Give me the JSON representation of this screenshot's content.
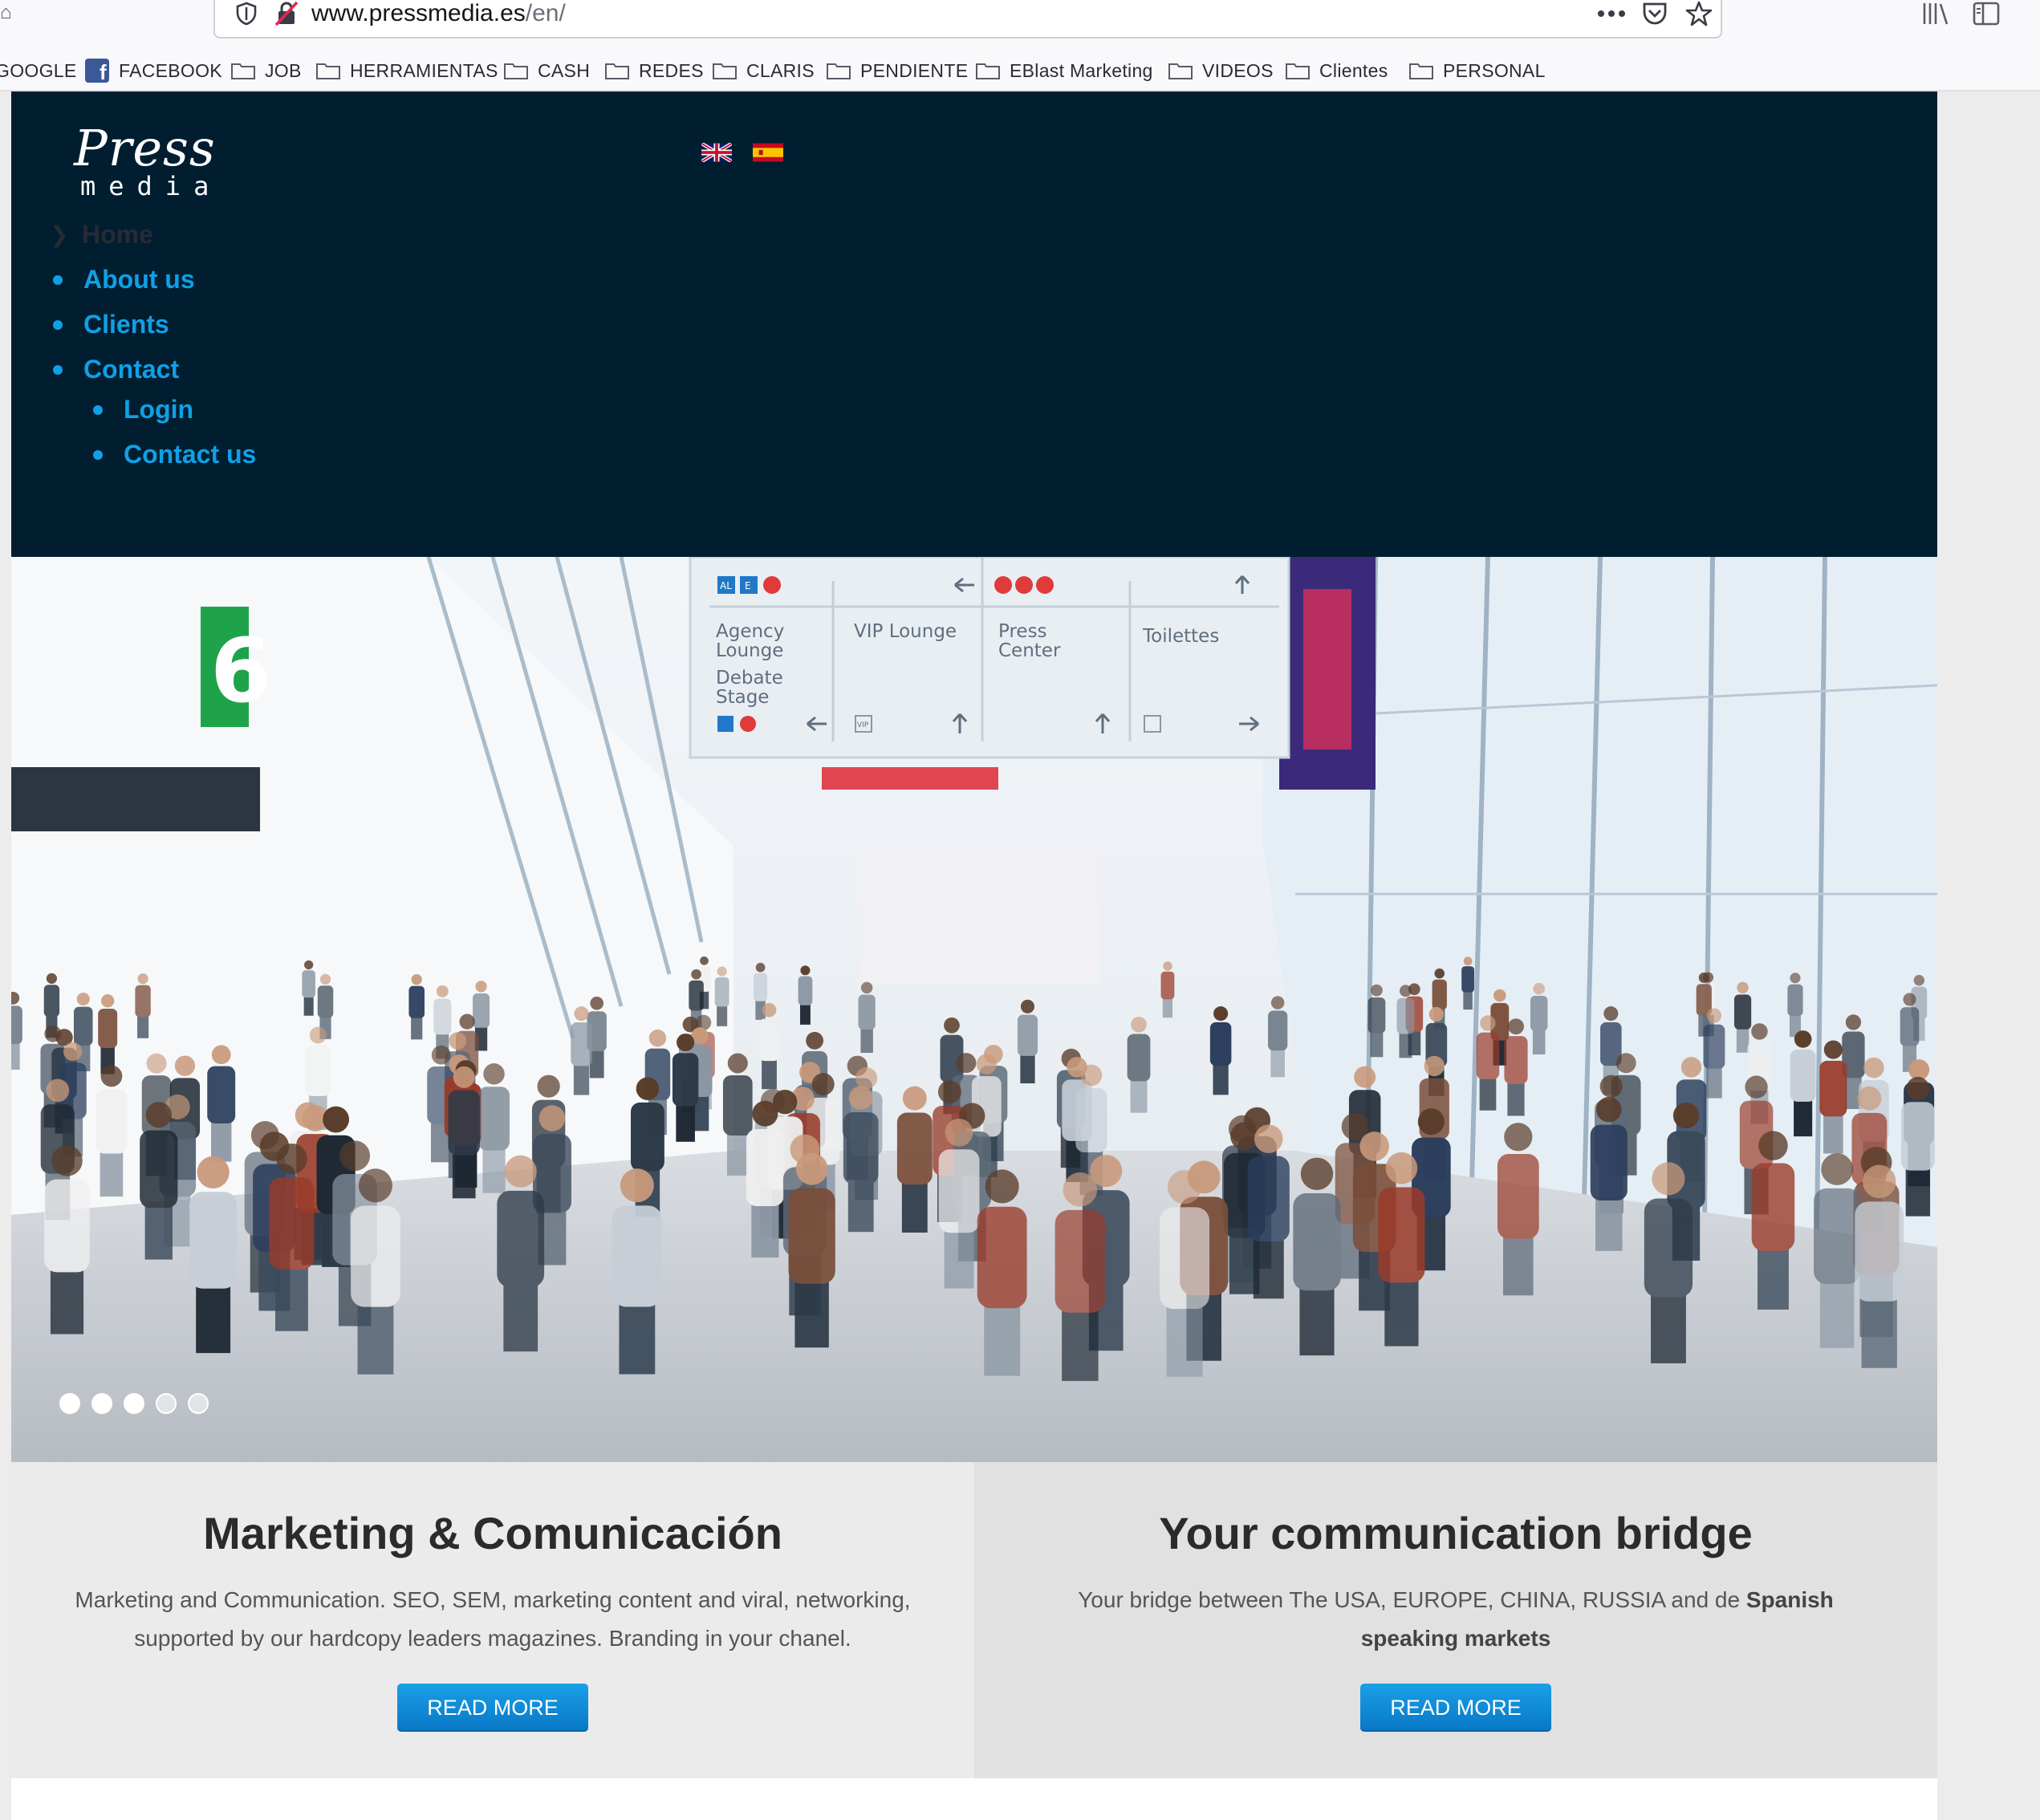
{
  "browser": {
    "url_host": "www.pressmedia.es",
    "url_path": "/en/",
    "bookmarks": [
      {
        "label": "GOOGLE",
        "icon": "none"
      },
      {
        "label": "FACEBOOK",
        "icon": "facebook-icon"
      },
      {
        "label": "JOB",
        "icon": "folder-icon"
      },
      {
        "label": "HERRAMIENTAS",
        "icon": "folder-icon"
      },
      {
        "label": "CASH",
        "icon": "folder-icon"
      },
      {
        "label": "REDES",
        "icon": "folder-icon"
      },
      {
        "label": "CLARIS",
        "icon": "folder-icon"
      },
      {
        "label": "PENDIENTE",
        "icon": "folder-icon"
      },
      {
        "label": "EBlast Marketing",
        "icon": "folder-icon"
      },
      {
        "label": "VIDEOS",
        "icon": "folder-icon"
      },
      {
        "label": "Clientes",
        "icon": "folder-icon"
      },
      {
        "label": "PERSONAL",
        "icon": "folder-icon"
      }
    ],
    "icons": [
      "shield-icon",
      "insecure-lock-icon",
      "more-icon",
      "pocket-icon",
      "star-icon",
      "library-icon",
      "sidebar-icon"
    ]
  },
  "site": {
    "logo_line1": "Press",
    "logo_line2": "media",
    "languages": [
      "uk-flag-icon",
      "spain-flag-icon"
    ],
    "nav": {
      "home": "Home",
      "about": "About us",
      "clients": "Clients",
      "contact": "Contact",
      "login": "Login",
      "contact_us": "Contact us"
    },
    "colors": {
      "header_bg": "#001e30",
      "accent": "#0fa0e6"
    }
  },
  "hero": {
    "sign": {
      "agency": "Agency",
      "lounge": "Lounge",
      "debate": "Debate",
      "stage": "Stage",
      "vip": "VIP Lounge",
      "press": "Press",
      "center": "Center",
      "toilettes": "Toilettes",
      "badge_al": "AL",
      "badge_e": "E",
      "badge_vip": "VIP"
    },
    "hall_number": "6",
    "slides": 5,
    "active_slide": 1
  },
  "panels": {
    "left": {
      "title": "Marketing & Comunicación",
      "body": "Marketing and Communication. SEO, SEM, marketing content and viral, networking, supported by our hardcopy leaders magazines. Branding in your chanel.",
      "button": "READ MORE"
    },
    "right": {
      "title": "Your communication bridge",
      "body_prefix": "Your bridge between The USA, EUROPE, CHINA, RUSSIA and de ",
      "body_bold": "Spanish speaking markets",
      "button": "READ MORE"
    }
  }
}
